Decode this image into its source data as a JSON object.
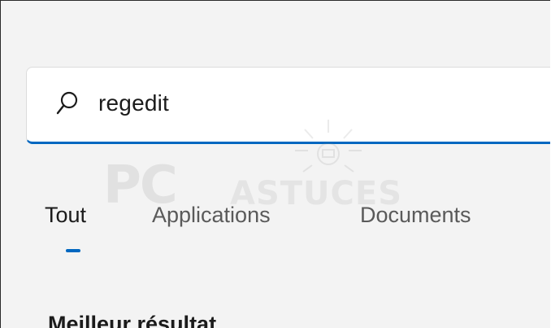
{
  "search": {
    "value": "regedit",
    "icon": "search-icon"
  },
  "tabs": [
    {
      "label": "Tout",
      "active": true
    },
    {
      "label": "Applications",
      "active": false
    },
    {
      "label": "Documents",
      "active": false
    }
  ],
  "section": {
    "title": "Meilleur résultat"
  },
  "watermark": {
    "brand_a": "PC",
    "brand_b": "ASTUCES"
  },
  "colors": {
    "accent": "#0067c0",
    "background": "#f3f3f3",
    "text": "#1b1b1b",
    "muted_text": "#5a5a5a"
  }
}
